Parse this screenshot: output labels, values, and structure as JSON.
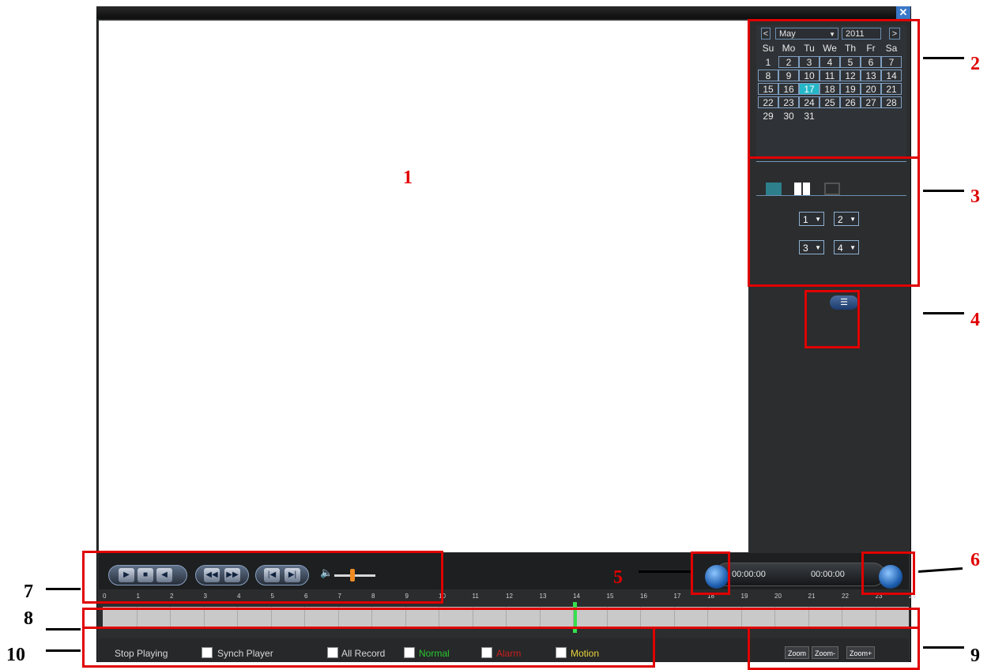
{
  "window": {
    "close_glyph": "✕"
  },
  "calendar": {
    "prev": "<",
    "month": "May",
    "year": "2011",
    "next": ">",
    "weekdays": [
      "Su",
      "Mo",
      "Tu",
      "We",
      "Th",
      "Fr",
      "Sa"
    ],
    "selected_day": "17",
    "days": [
      [
        "1",
        "2",
        "3",
        "4",
        "5",
        "6",
        "7"
      ],
      [
        "8",
        "9",
        "10",
        "11",
        "12",
        "13",
        "14"
      ],
      [
        "15",
        "16",
        "17",
        "18",
        "19",
        "20",
        "21"
      ],
      [
        "22",
        "23",
        "24",
        "25",
        "26",
        "27",
        "28"
      ],
      [
        "29",
        "30",
        "31",
        "",
        "",
        "",
        "",
        ""
      ]
    ]
  },
  "layout": {
    "selectors": [
      "1",
      "2",
      "3",
      "4"
    ]
  },
  "playback": {
    "start_time": "00:00:00",
    "end_time": "00:00:00",
    "volume_level": 0.45
  },
  "timeline": {
    "hours": [
      "0",
      "1",
      "2",
      "3",
      "4",
      "5",
      "6",
      "7",
      "8",
      "9",
      "10",
      "11",
      "12",
      "13",
      "14",
      "15",
      "16",
      "17",
      "18",
      "19",
      "20",
      "21",
      "22",
      "23",
      "24"
    ],
    "cursor_hour": 14
  },
  "bottom": {
    "status": "Stop Playing",
    "sync_label": "Synch Player",
    "all_record_label": "All Record",
    "normal_label": "Normal",
    "alarm_label": "Alarm",
    "motion_label": "Motion",
    "colors": {
      "normal": "#29c82f",
      "alarm": "#cc1f1f",
      "motion": "#e8d23a"
    },
    "zoom_buttons": [
      "Zoom",
      "Zoom-",
      "Zoom+"
    ]
  },
  "callouts": [
    "1",
    "2",
    "3",
    "4",
    "5",
    "6",
    "7",
    "8",
    "9",
    "10"
  ]
}
